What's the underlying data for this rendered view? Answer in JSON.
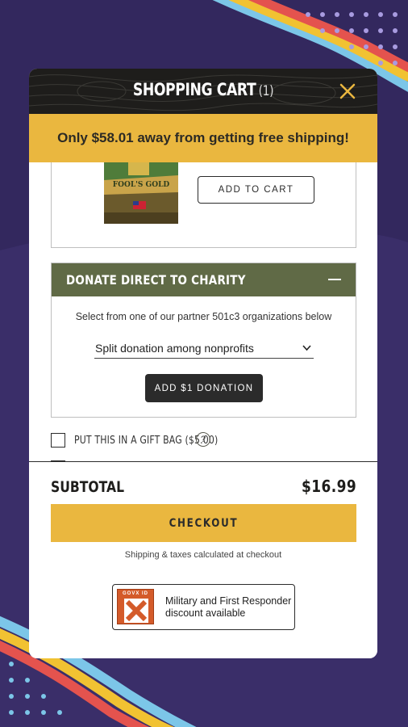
{
  "colors": {
    "background": "#3a2e69",
    "header": "#1e1d1b",
    "accent": "#eab73f",
    "donate_header": "#606a46",
    "close_icon": "#eab73f"
  },
  "header": {
    "title": "SHOPPING CART",
    "count": "(1)",
    "close_icon": "close-icon"
  },
  "banner": {
    "text": "Only $58.01 away from getting free shipping!"
  },
  "product": {
    "image_alt": "coffee-bag",
    "bag_label": "FOOL'S GOLD",
    "add_to_cart_label": "ADD TO CART"
  },
  "donate": {
    "title": "DONATE DIRECT TO CHARITY",
    "collapse_icon": "minus-icon",
    "subtitle": "Select from one of our partner 501c3 organizations below",
    "selected_option": "Split donation among nonprofits",
    "button_label": "ADD $1 DONATION"
  },
  "gift": {
    "label": "PUT THIS IN A GIFT BAG ($5.00)",
    "help_label": "?",
    "checked": false
  },
  "footer": {
    "subtotal_label": "SUBTOTAL",
    "subtotal_value": "$16.99",
    "checkout_label": "CHECKOUT",
    "shipping_note": "Shipping & taxes calculated at checkout",
    "govx": {
      "logo_tag": "GOVX ID",
      "line1": "Military and First Responder",
      "line2": "discount available"
    }
  }
}
